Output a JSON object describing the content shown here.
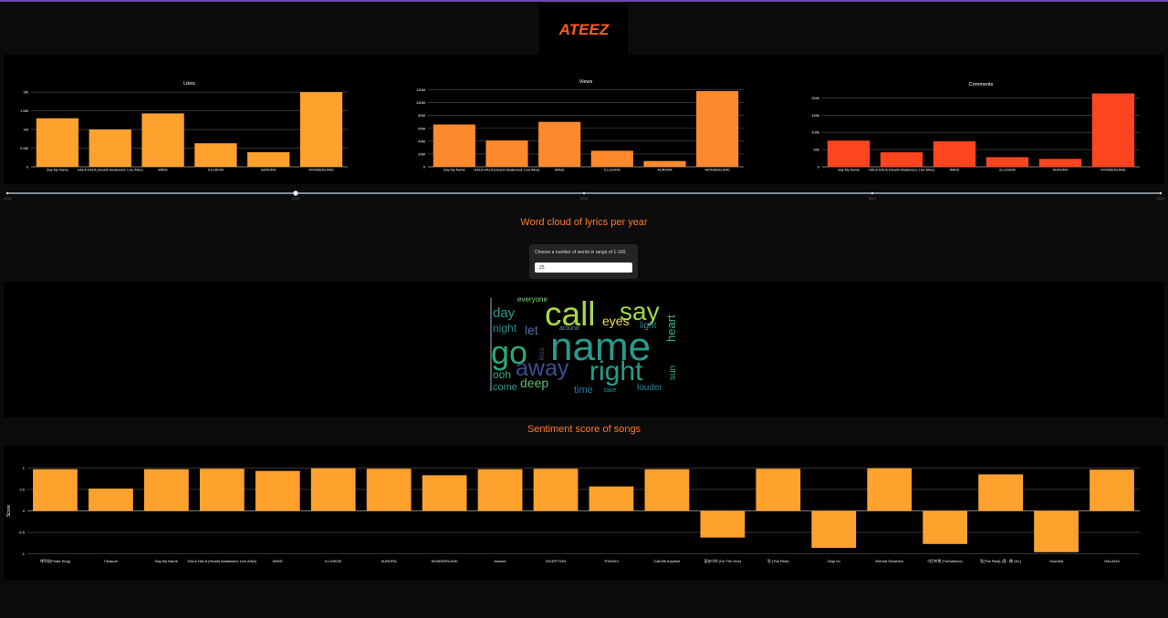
{
  "logo": {
    "text": "ATEEZ",
    "color": "#ff5a1f"
  },
  "slider": {
    "years": [
      "2018",
      "2019",
      "2020",
      "2021",
      "2022"
    ],
    "selected_index": 1
  },
  "wordcloud": {
    "title": "Word cloud of lyrics per year",
    "control_label": "Choose a number of words in range of 1-100.",
    "input_value": "25",
    "words": [
      "everyone",
      "call",
      "say",
      "day",
      "eyes",
      "night",
      "let",
      "around",
      "light",
      "heart",
      "go",
      "name",
      "kiss",
      "away",
      "right",
      "sun",
      "ooh",
      "deep",
      "come",
      "time",
      "take",
      "louder"
    ]
  },
  "sentiment_title": "Sentiment score of songs",
  "chart_data": [
    {
      "type": "bar",
      "title": "Likes",
      "categories": [
        "Say My Name",
        "HALA HALA (Hearts Awakened, Live Alive)",
        "WAVE",
        "ILLUSION",
        "AURORA",
        "WONDERLAND"
      ],
      "values": [
        1300000,
        1000000,
        1430000,
        630000,
        390000,
        2000000
      ],
      "ylim": [
        0,
        2100000
      ],
      "yticks": [
        0,
        500000,
        1000000,
        1500000,
        2000000
      ],
      "ytick_labels": [
        "0",
        "0.5M",
        "1M",
        "1.5M",
        "2M"
      ],
      "color": "#ffa12d"
    },
    {
      "type": "bar",
      "title": "Views",
      "categories": [
        "Say My Name",
        "HALA HALA (Hearts Awakened, Live Alive)",
        "WAVE",
        "ILLUSION",
        "AURORA",
        "WONDERLAND"
      ],
      "values": [
        66000000,
        41000000,
        70000000,
        25000000,
        9000000,
        118000000
      ],
      "ylim": [
        0,
        125000000
      ],
      "yticks": [
        0,
        20000000,
        40000000,
        60000000,
        80000000,
        100000000,
        120000000
      ],
      "ytick_labels": [
        "0",
        "20M",
        "40M",
        "60M",
        "80M",
        "100M",
        "120M"
      ],
      "color": "#ff8a2d"
    },
    {
      "type": "bar",
      "title": "Comments",
      "categories": [
        "Say My Name",
        "HALA HALA (Hearts Awakened, Live Alive)",
        "WAVE",
        "ILLUSION",
        "AURORA",
        "WONDERLAND"
      ],
      "values": [
        76000,
        42000,
        74000,
        28000,
        23000,
        213000
      ],
      "ylim": [
        0,
        225000
      ],
      "yticks": [
        0,
        50000,
        100000,
        150000,
        200000
      ],
      "ytick_labels": [
        "0",
        "50k",
        "100k",
        "150k",
        "200k"
      ],
      "color": "#ff4420"
    },
    {
      "type": "bar",
      "title": "",
      "ylabel": "Score",
      "categories": [
        "해적왕(Pirate King)",
        "Treasure",
        "Say My Name",
        "HALA HALA (Hearts Awakened, Live Alive)",
        "WAVE",
        "ILLUSION",
        "AURORA",
        "WONDERLAND",
        "Answer",
        "INCEPTION",
        "THANXX",
        "Call Me Anytime",
        "불놀이야 (I'm The One)",
        "멋 (The Real)",
        "Deja Vu",
        "Eternal Sunshine",
        "야간비행 (Turbulence)",
        "멋(The Real) (흥 : 興 Ver.)",
        "Guerrilla",
        "HALAZIA"
      ],
      "values": [
        0.97,
        0.52,
        0.97,
        0.98,
        0.93,
        0.99,
        0.98,
        0.83,
        0.97,
        0.98,
        0.57,
        0.97,
        -0.62,
        0.98,
        -0.86,
        0.99,
        -0.77,
        0.85,
        -0.96,
        0.96
      ],
      "ylim": [
        -1.05,
        1.05
      ],
      "yticks": [
        -1,
        -0.5,
        0,
        0.5,
        1
      ],
      "ytick_labels": [
        "-1",
        "-0.5",
        "0",
        "0.5",
        "1"
      ],
      "color": "#ffa12d"
    }
  ]
}
